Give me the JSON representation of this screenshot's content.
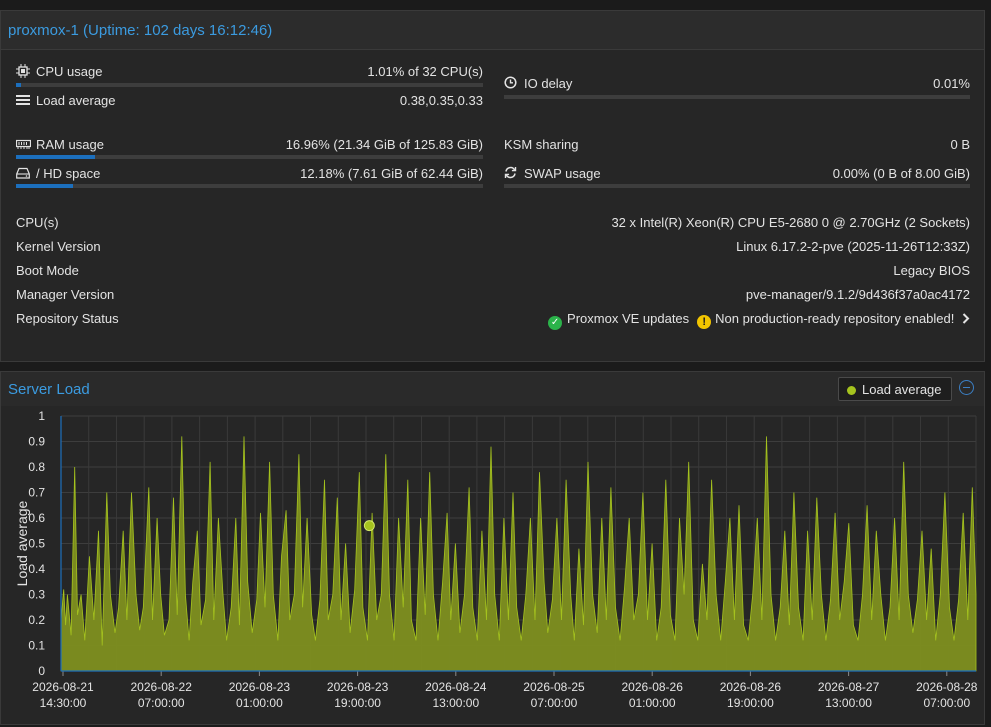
{
  "node": {
    "title": "proxmox-1 (Uptime: 102 days 16:12:46)"
  },
  "status": {
    "cpu": {
      "label": "CPU usage",
      "value": "1.01% of 32 CPU(s)",
      "fraction": 0.0101
    },
    "load": {
      "label": "Load average",
      "value": "0.38,0.35,0.33"
    },
    "io_delay": {
      "label": "IO delay",
      "value": "0.01%",
      "fraction": 0.0001
    },
    "ram": {
      "label": "RAM usage",
      "value": "16.96% (21.34 GiB of 125.83 GiB)",
      "fraction": 0.1696
    },
    "hd": {
      "label": "/ HD space",
      "value": "12.18% (7.61 GiB of 62.44 GiB)",
      "fraction": 0.1218
    },
    "ksm": {
      "label": "KSM sharing",
      "value": "0 B"
    },
    "swap": {
      "label": "SWAP usage",
      "value": "0.00% (0 B of 8.00 GiB)",
      "fraction": 0.0
    }
  },
  "info": {
    "cpus": {
      "label": "CPU(s)",
      "value": "32 x Intel(R) Xeon(R) CPU E5-2680 0 @ 2.70GHz (2 Sockets)"
    },
    "kernel": {
      "label": "Kernel Version",
      "value": "Linux 6.17.2-2-pve (2025-11-26T12:33Z)"
    },
    "boot": {
      "label": "Boot Mode",
      "value": "Legacy BIOS"
    },
    "manager": {
      "label": "Manager Version",
      "value": "pve-manager/9.1.2/9d436f37a0ac4172"
    },
    "repo": {
      "label": "Repository Status",
      "ok_text": "Proxmox VE updates",
      "warn_text": "Non production-ready repository enabled!"
    }
  },
  "load_panel": {
    "title": "Server Load",
    "legend_label": "Load average"
  },
  "chart_data": {
    "type": "area",
    "ylabel": "Load average",
    "ylim": [
      0,
      1
    ],
    "yticks": [
      "1",
      "0.9",
      "0.8",
      "0.7",
      "0.6",
      "0.5",
      "0.4",
      "0.3",
      "0.2",
      "0.1",
      "0"
    ],
    "xticks": [
      [
        "2026-08-21",
        "14:30:00"
      ],
      [
        "2026-08-22",
        "07:00:00"
      ],
      [
        "2026-08-23",
        "01:00:00"
      ],
      [
        "2026-08-23",
        "19:00:00"
      ],
      [
        "2026-08-24",
        "13:00:00"
      ],
      [
        "2026-08-25",
        "07:00:00"
      ],
      [
        "2026-08-26",
        "01:00:00"
      ],
      [
        "2026-08-26",
        "19:00:00"
      ],
      [
        "2026-08-27",
        "13:00:00"
      ],
      [
        "2026-08-28",
        "07:00:00"
      ]
    ],
    "series": [
      {
        "name": "Load average",
        "color": "#a5c31e"
      }
    ],
    "peaks": [
      [
        0.0,
        0.2
      ],
      [
        0.3,
        0.32
      ],
      [
        0.5,
        0.18
      ],
      [
        0.7,
        0.3
      ],
      [
        1.1,
        0.14
      ],
      [
        1.5,
        0.8
      ],
      [
        1.8,
        0.22
      ],
      [
        2.2,
        0.3
      ],
      [
        2.6,
        0.12
      ],
      [
        3.1,
        0.45
      ],
      [
        3.6,
        0.2
      ],
      [
        4.1,
        0.55
      ],
      [
        4.5,
        0.1
      ],
      [
        5.0,
        0.7
      ],
      [
        5.4,
        0.3
      ],
      [
        5.9,
        0.15
      ],
      [
        6.3,
        0.25
      ],
      [
        6.8,
        0.55
      ],
      [
        7.2,
        0.2
      ],
      [
        7.7,
        0.7
      ],
      [
        8.2,
        0.3
      ],
      [
        8.6,
        0.16
      ],
      [
        9.0,
        0.25
      ],
      [
        9.6,
        0.72
      ],
      [
        10.0,
        0.2
      ],
      [
        10.5,
        0.6
      ],
      [
        10.9,
        0.3
      ],
      [
        11.3,
        0.14
      ],
      [
        11.8,
        0.2
      ],
      [
        12.3,
        0.68
      ],
      [
        12.7,
        0.22
      ],
      [
        13.2,
        0.92
      ],
      [
        13.6,
        0.3
      ],
      [
        14.0,
        0.12
      ],
      [
        14.4,
        0.35
      ],
      [
        14.9,
        0.55
      ],
      [
        15.3,
        0.18
      ],
      [
        15.8,
        0.28
      ],
      [
        16.3,
        0.82
      ],
      [
        16.7,
        0.2
      ],
      [
        17.2,
        0.6
      ],
      [
        17.7,
        0.3
      ],
      [
        18.1,
        0.12
      ],
      [
        18.6,
        0.25
      ],
      [
        19.1,
        0.6
      ],
      [
        19.5,
        0.18
      ],
      [
        20.0,
        0.92
      ],
      [
        20.4,
        0.35
      ],
      [
        20.9,
        0.15
      ],
      [
        21.4,
        0.28
      ],
      [
        21.8,
        0.62
      ],
      [
        22.3,
        0.25
      ],
      [
        22.8,
        0.82
      ],
      [
        23.2,
        0.3
      ],
      [
        23.7,
        0.12
      ],
      [
        24.1,
        0.45
      ],
      [
        24.6,
        0.63
      ],
      [
        25.0,
        0.2
      ],
      [
        25.5,
        0.3
      ],
      [
        26.0,
        0.85
      ],
      [
        26.4,
        0.25
      ],
      [
        26.9,
        0.6
      ],
      [
        27.4,
        0.22
      ],
      [
        27.8,
        0.12
      ],
      [
        28.3,
        0.28
      ],
      [
        28.8,
        0.75
      ],
      [
        29.2,
        0.2
      ],
      [
        29.7,
        0.3
      ],
      [
        30.2,
        0.68
      ],
      [
        30.6,
        0.2
      ],
      [
        31.1,
        0.5
      ],
      [
        31.6,
        0.15
      ],
      [
        32.1,
        0.32
      ],
      [
        32.6,
        0.78
      ],
      [
        33.0,
        0.25
      ],
      [
        33.5,
        0.12
      ],
      [
        34.0,
        0.62
      ],
      [
        34.5,
        0.2
      ],
      [
        35.0,
        0.3
      ],
      [
        35.5,
        0.85
      ],
      [
        35.9,
        0.3
      ],
      [
        36.4,
        0.12
      ],
      [
        36.9,
        0.6
      ],
      [
        37.4,
        0.25
      ],
      [
        37.9,
        0.75
      ],
      [
        38.3,
        0.2
      ],
      [
        38.8,
        0.12
      ],
      [
        39.3,
        0.6
      ],
      [
        39.8,
        0.22
      ],
      [
        40.3,
        0.78
      ],
      [
        40.7,
        0.3
      ],
      [
        41.2,
        0.12
      ],
      [
        41.7,
        0.35
      ],
      [
        42.2,
        0.62
      ],
      [
        42.6,
        0.2
      ],
      [
        43.1,
        0.5
      ],
      [
        43.6,
        0.15
      ],
      [
        44.1,
        0.3
      ],
      [
        44.6,
        0.72
      ],
      [
        45.0,
        0.25
      ],
      [
        45.5,
        0.12
      ],
      [
        46.0,
        0.55
      ],
      [
        46.5,
        0.2
      ],
      [
        47.0,
        0.88
      ],
      [
        47.4,
        0.3
      ],
      [
        47.9,
        0.12
      ],
      [
        48.4,
        0.6
      ],
      [
        48.9,
        0.2
      ],
      [
        49.4,
        0.7
      ],
      [
        49.8,
        0.25
      ],
      [
        50.3,
        0.12
      ],
      [
        50.8,
        0.3
      ],
      [
        51.3,
        0.6
      ],
      [
        51.8,
        0.2
      ],
      [
        52.3,
        0.78
      ],
      [
        52.8,
        0.35
      ],
      [
        53.2,
        0.15
      ],
      [
        53.7,
        0.28
      ],
      [
        54.2,
        0.6
      ],
      [
        54.7,
        0.2
      ],
      [
        55.2,
        0.75
      ],
      [
        55.7,
        0.3
      ],
      [
        56.1,
        0.12
      ],
      [
        56.6,
        0.48
      ],
      [
        57.1,
        0.18
      ],
      [
        57.6,
        0.82
      ],
      [
        58.1,
        0.3
      ],
      [
        58.6,
        0.15
      ],
      [
        59.1,
        0.6
      ],
      [
        59.6,
        0.2
      ],
      [
        60.1,
        0.72
      ],
      [
        60.6,
        0.25
      ],
      [
        61.1,
        0.12
      ],
      [
        61.6,
        0.33
      ],
      [
        62.1,
        0.6
      ],
      [
        62.6,
        0.2
      ],
      [
        63.1,
        0.3
      ],
      [
        63.6,
        0.7
      ],
      [
        64.1,
        0.2
      ],
      [
        64.6,
        0.5
      ],
      [
        65.1,
        0.12
      ],
      [
        65.6,
        0.25
      ],
      [
        66.1,
        0.75
      ],
      [
        66.6,
        0.22
      ],
      [
        67.1,
        0.12
      ],
      [
        67.6,
        0.6
      ],
      [
        68.1,
        0.3
      ],
      [
        68.6,
        0.82
      ],
      [
        69.1,
        0.2
      ],
      [
        69.6,
        0.12
      ],
      [
        70.1,
        0.42
      ],
      [
        70.6,
        0.2
      ],
      [
        71.1,
        0.75
      ],
      [
        71.6,
        0.3
      ],
      [
        72.1,
        0.12
      ],
      [
        72.6,
        0.35
      ],
      [
        73.1,
        0.6
      ],
      [
        73.6,
        0.2
      ],
      [
        74.1,
        0.65
      ],
      [
        74.6,
        0.18
      ],
      [
        75.1,
        0.12
      ],
      [
        75.6,
        0.3
      ],
      [
        76.1,
        0.6
      ],
      [
        76.6,
        0.2
      ],
      [
        77.1,
        0.92
      ],
      [
        77.6,
        0.3
      ],
      [
        78.1,
        0.12
      ],
      [
        78.6,
        0.25
      ],
      [
        79.1,
        0.55
      ],
      [
        79.6,
        0.18
      ],
      [
        80.1,
        0.7
      ],
      [
        80.6,
        0.25
      ],
      [
        81.1,
        0.12
      ],
      [
        81.6,
        0.55
      ],
      [
        82.1,
        0.2
      ],
      [
        82.6,
        0.68
      ],
      [
        83.1,
        0.3
      ],
      [
        83.6,
        0.12
      ],
      [
        84.1,
        0.28
      ],
      [
        84.6,
        0.62
      ],
      [
        85.1,
        0.2
      ],
      [
        85.6,
        0.35
      ],
      [
        86.1,
        0.58
      ],
      [
        86.6,
        0.18
      ],
      [
        87.1,
        0.12
      ],
      [
        87.6,
        0.3
      ],
      [
        88.1,
        0.65
      ],
      [
        88.6,
        0.2
      ],
      [
        89.1,
        0.55
      ],
      [
        89.6,
        0.3
      ],
      [
        90.1,
        0.12
      ],
      [
        90.6,
        0.25
      ],
      [
        91.1,
        0.6
      ],
      [
        91.6,
        0.2
      ],
      [
        92.1,
        0.82
      ],
      [
        92.6,
        0.3
      ],
      [
        93.1,
        0.15
      ],
      [
        93.6,
        0.28
      ],
      [
        94.1,
        0.55
      ],
      [
        94.6,
        0.2
      ],
      [
        95.1,
        0.48
      ],
      [
        95.6,
        0.12
      ],
      [
        96.1,
        0.3
      ],
      [
        96.6,
        0.7
      ],
      [
        97.1,
        0.25
      ],
      [
        97.6,
        0.12
      ],
      [
        98.1,
        0.28
      ],
      [
        98.6,
        0.62
      ],
      [
        99.1,
        0.2
      ],
      [
        99.6,
        0.72
      ],
      [
        100.0,
        0.3
      ]
    ],
    "highlight_point": [
      33.7,
      0.57
    ]
  }
}
